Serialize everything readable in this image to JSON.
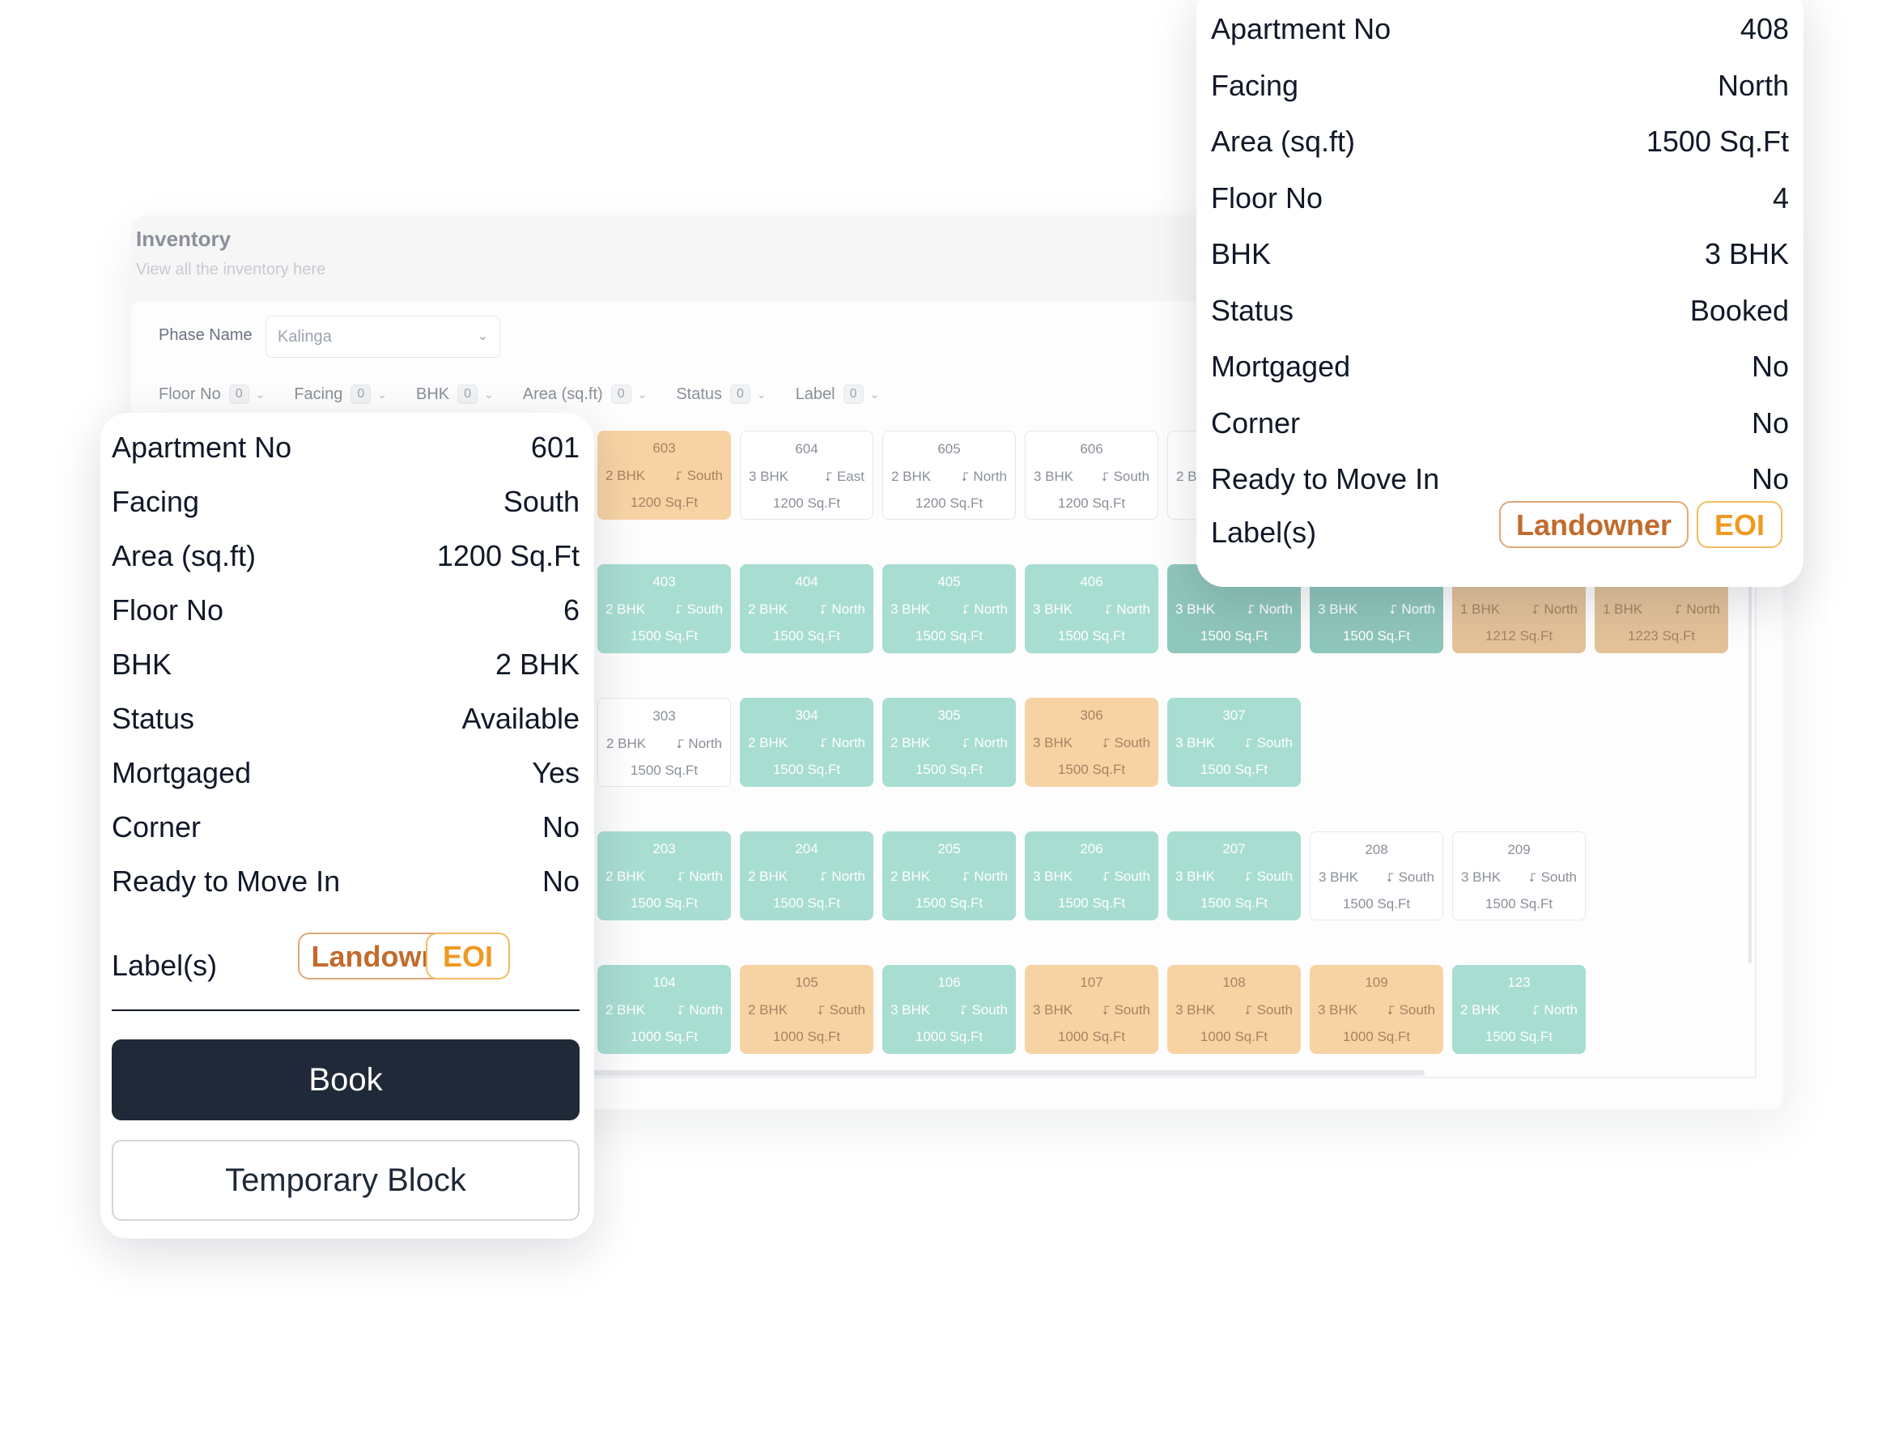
{
  "inventory": {
    "title": "Inventory",
    "subtitle": "View all the inventory here",
    "phase_label": "Phase Name",
    "phase_value": "Kalinga",
    "filters": [
      {
        "label": "Floor No",
        "count": "0"
      },
      {
        "label": "Facing",
        "count": "0"
      },
      {
        "label": "BHK",
        "count": "0"
      },
      {
        "label": "Area (sq.ft)",
        "count": "0"
      },
      {
        "label": "Status",
        "count": "0"
      },
      {
        "label": "Label",
        "count": "0"
      }
    ],
    "rows": [
      [
        {
          "no": "603",
          "bhk": "2 BHK",
          "dir": "South",
          "area": "1200 Sq.Ft",
          "status": "booked"
        },
        {
          "no": "604",
          "bhk": "3 BHK",
          "dir": "East",
          "area": "1200 Sq.Ft",
          "status": "open"
        },
        {
          "no": "605",
          "bhk": "2 BHK",
          "dir": "North",
          "area": "1200 Sq.Ft",
          "status": "open"
        },
        {
          "no": "606",
          "bhk": "3 BHK",
          "dir": "South",
          "area": "1200 Sq.Ft",
          "status": "open"
        },
        {
          "no": "",
          "bhk": "2 B",
          "dir": "",
          "area": "",
          "status": "open",
          "cut": true
        }
      ],
      [
        {
          "no": "403",
          "bhk": "2 BHK",
          "dir": "South",
          "area": "1500 Sq.Ft",
          "status": "available"
        },
        {
          "no": "404",
          "bhk": "2 BHK",
          "dir": "North",
          "area": "1500 Sq.Ft",
          "status": "available"
        },
        {
          "no": "405",
          "bhk": "3 BHK",
          "dir": "North",
          "area": "1500 Sq.Ft",
          "status": "available"
        },
        {
          "no": "406",
          "bhk": "3 BHK",
          "dir": "North",
          "area": "1500 Sq.Ft",
          "status": "available"
        },
        {
          "no": "",
          "bhk": "3 BHK",
          "dir": "North",
          "area": "1500 Sq.Ft",
          "status": "available",
          "dim": true
        },
        {
          "no": "",
          "bhk": "3 BHK",
          "dir": "North",
          "area": "1500 Sq.Ft",
          "status": "available",
          "dim": true
        },
        {
          "no": "",
          "bhk": "1 BHK",
          "dir": "North",
          "area": "1212 Sq.Ft",
          "status": "booked",
          "dim": true
        },
        {
          "no": "",
          "bhk": "1 BHK",
          "dir": "North",
          "area": "1223 Sq.Ft",
          "status": "booked",
          "dim": true
        }
      ],
      [
        {
          "no": "303",
          "bhk": "2 BHK",
          "dir": "North",
          "area": "1500 Sq.Ft",
          "status": "open"
        },
        {
          "no": "304",
          "bhk": "2 BHK",
          "dir": "North",
          "area": "1500 Sq.Ft",
          "status": "available"
        },
        {
          "no": "305",
          "bhk": "2 BHK",
          "dir": "North",
          "area": "1500 Sq.Ft",
          "status": "available"
        },
        {
          "no": "306",
          "bhk": "3 BHK",
          "dir": "South",
          "area": "1500 Sq.Ft",
          "status": "booked"
        },
        {
          "no": "307",
          "bhk": "3 BHK",
          "dir": "South",
          "area": "1500 Sq.Ft",
          "status": "available"
        }
      ],
      [
        {
          "no": "203",
          "bhk": "2 BHK",
          "dir": "North",
          "area": "1500 Sq.Ft",
          "status": "available"
        },
        {
          "no": "204",
          "bhk": "2 BHK",
          "dir": "North",
          "area": "1500 Sq.Ft",
          "status": "available"
        },
        {
          "no": "205",
          "bhk": "2 BHK",
          "dir": "North",
          "area": "1500 Sq.Ft",
          "status": "available"
        },
        {
          "no": "206",
          "bhk": "3 BHK",
          "dir": "South",
          "area": "1500 Sq.Ft",
          "status": "available"
        },
        {
          "no": "207",
          "bhk": "3 BHK",
          "dir": "South",
          "area": "1500 Sq.Ft",
          "status": "available"
        },
        {
          "no": "208",
          "bhk": "3 BHK",
          "dir": "South",
          "area": "1500 Sq.Ft",
          "status": "open"
        },
        {
          "no": "209",
          "bhk": "3 BHK",
          "dir": "South",
          "area": "1500 Sq.Ft",
          "status": "open"
        }
      ],
      [
        {
          "no": "104",
          "bhk": "2 BHK",
          "dir": "North",
          "area": "1000 Sq.Ft",
          "status": "available"
        },
        {
          "no": "105",
          "bhk": "2 BHK",
          "dir": "South",
          "area": "1000 Sq.Ft",
          "status": "booked"
        },
        {
          "no": "106",
          "bhk": "3 BHK",
          "dir": "South",
          "area": "1000 Sq.Ft",
          "status": "available"
        },
        {
          "no": "107",
          "bhk": "3 BHK",
          "dir": "South",
          "area": "1000 Sq.Ft",
          "status": "booked"
        },
        {
          "no": "108",
          "bhk": "3 BHK",
          "dir": "South",
          "area": "1000 Sq.Ft",
          "status": "booked"
        },
        {
          "no": "109",
          "bhk": "3 BHK",
          "dir": "South",
          "area": "1000 Sq.Ft",
          "status": "booked"
        },
        {
          "no": "123",
          "bhk": "2 BHK",
          "dir": "North",
          "area": "1500 Sq.Ft",
          "status": "available"
        }
      ]
    ]
  },
  "popup_left": {
    "rows": [
      {
        "key": "Apartment No",
        "value": "601"
      },
      {
        "key": "Facing",
        "value": "South"
      },
      {
        "key": "Area (sq.ft)",
        "value": "1200 Sq.Ft"
      },
      {
        "key": "Floor No",
        "value": "6"
      },
      {
        "key": "BHK",
        "value": "2 BHK"
      },
      {
        "key": "Status",
        "value": "Available"
      },
      {
        "key": "Mortgaged",
        "value": "Yes"
      },
      {
        "key": "Corner",
        "value": "No"
      },
      {
        "key": "Ready to Move In",
        "value": "No"
      }
    ],
    "labels_key": "Label(s)",
    "labels": [
      "Landowner",
      "EOI"
    ],
    "book_label": "Book",
    "temp_block_label": "Temporary Block"
  },
  "popup_right": {
    "rows": [
      {
        "key": "Apartment No",
        "value": "408"
      },
      {
        "key": "Facing",
        "value": "North"
      },
      {
        "key": "Area (sq.ft)",
        "value": "1500 Sq.Ft"
      },
      {
        "key": "Floor No",
        "value": "4"
      },
      {
        "key": "BHK",
        "value": "3 BHK"
      },
      {
        "key": "Status",
        "value": "Booked"
      },
      {
        "key": "Mortgaged",
        "value": "No"
      },
      {
        "key": "Corner",
        "value": "No"
      },
      {
        "key": "Ready to Move In",
        "value": "No"
      }
    ],
    "labels_key": "Label(s)",
    "labels": [
      "Landowner",
      "EOI"
    ]
  },
  "colors": {
    "available": "#a8ddd2",
    "booked": "#f7d3a4",
    "book_button": "#1f2937",
    "landowner": "#c26b2c",
    "eoi": "#ee9a22"
  }
}
